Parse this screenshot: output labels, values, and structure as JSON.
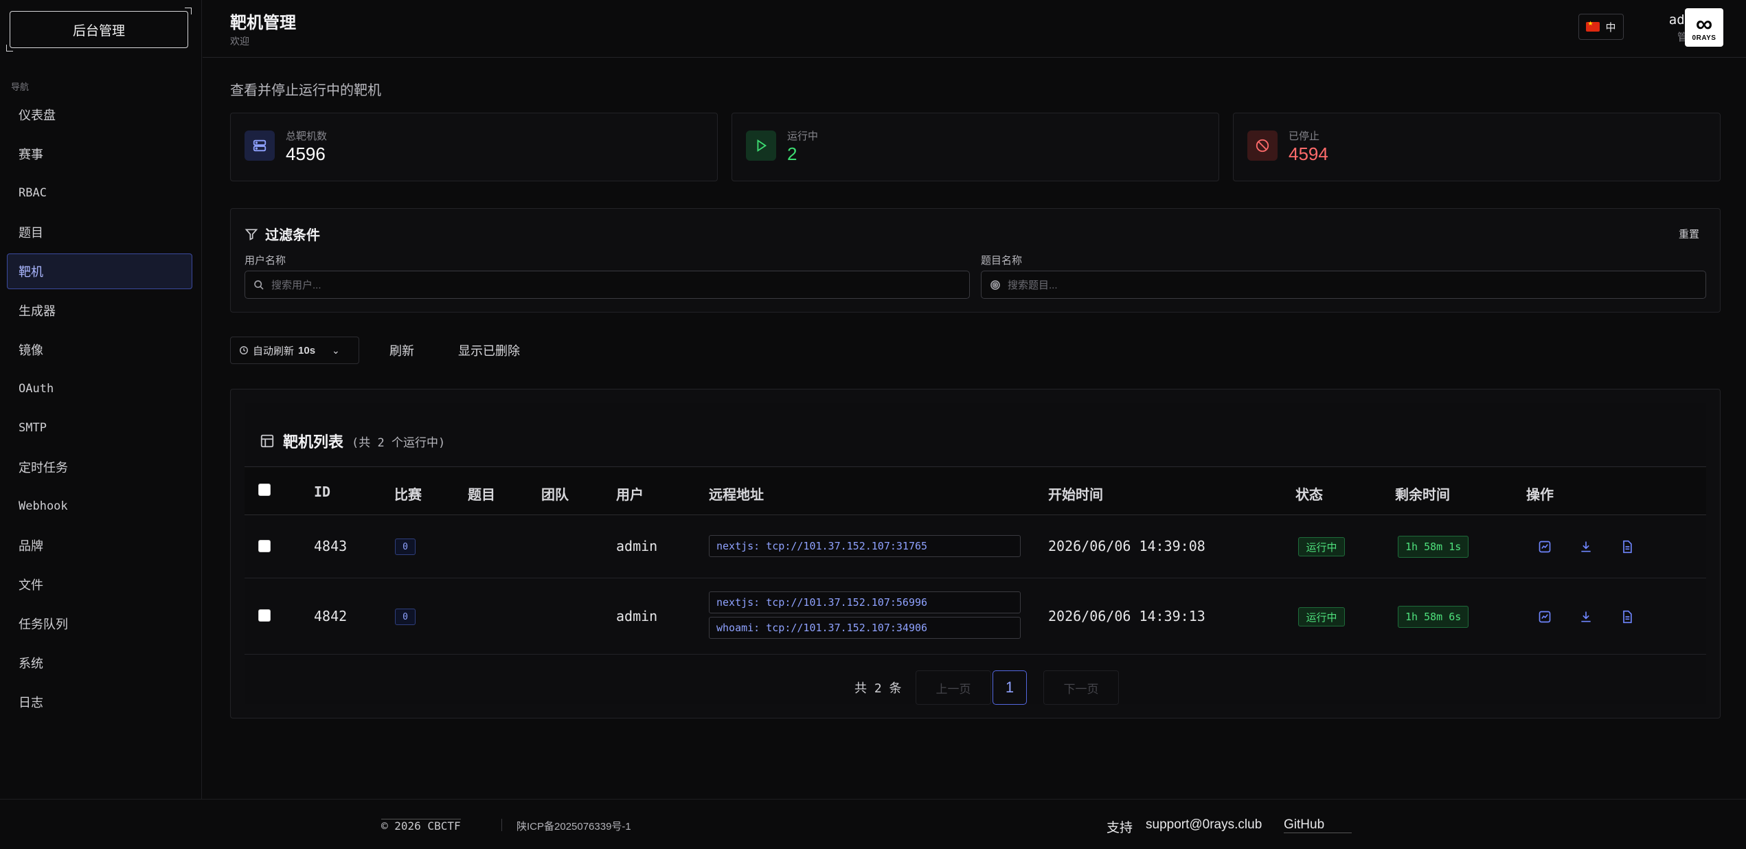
{
  "sidebar": {
    "brand": "后台管理",
    "nav_title": "导航",
    "items": [
      {
        "label": "仪表盘"
      },
      {
        "label": "赛事"
      },
      {
        "label": "RBAC"
      },
      {
        "label": "题目"
      },
      {
        "label": "靶机"
      },
      {
        "label": "生成器"
      },
      {
        "label": "镜像"
      },
      {
        "label": "OAuth"
      },
      {
        "label": "SMTP"
      },
      {
        "label": "定时任务"
      },
      {
        "label": "Webhook"
      },
      {
        "label": "品牌"
      },
      {
        "label": "文件"
      },
      {
        "label": "任务队列"
      },
      {
        "label": "系统"
      },
      {
        "label": "日志"
      }
    ],
    "active_index": 4
  },
  "header": {
    "title": "靶机管理",
    "subtitle": "欢迎",
    "lang": "中",
    "user_name": "admin",
    "user_role": "管理员",
    "avatar_text": "0RAYS"
  },
  "main": {
    "description": "查看并停止运行中的靶机",
    "stats": [
      {
        "label": "总靶机数",
        "value": "4596",
        "color": "#ffffff",
        "icon": "server-icon"
      },
      {
        "label": "运行中",
        "value": "2",
        "color": "#3ddc72",
        "icon": "play-icon"
      },
      {
        "label": "已停止",
        "value": "4594",
        "color": "#ff6b6b",
        "icon": "ban-icon"
      }
    ],
    "filter": {
      "title": "过滤条件",
      "reset": "重置",
      "user_label": "用户名称",
      "user_placeholder": "搜索用户...",
      "challenge_label": "题目名称",
      "challenge_placeholder": "搜索题目..."
    },
    "toolbar": {
      "auto_refresh": "自动刷新",
      "interval": "10s",
      "refresh": "刷新",
      "show_deleted": "显示已删除"
    },
    "table": {
      "title": "靶机列表",
      "count_text": "(共 2 个运行中)",
      "columns": [
        "ID",
        "比赛",
        "题目",
        "团队",
        "用户",
        "远程地址",
        "开始时间",
        "状态",
        "剩余时间",
        "操作"
      ],
      "rows": [
        {
          "id": "4843",
          "contest": "0",
          "challenge": "",
          "team": "",
          "user": "admin",
          "addresses": [
            "nextjs: tcp://101.37.152.107:31765"
          ],
          "start": "2026/06/06 14:39:08",
          "status": "运行中",
          "remaining": "1h 58m 1s"
        },
        {
          "id": "4842",
          "contest": "0",
          "challenge": "",
          "team": "",
          "user": "admin",
          "addresses": [
            "nextjs: tcp://101.37.152.107:56996",
            "whoami: tcp://101.37.152.107:34906"
          ],
          "start": "2026/06/06 14:39:13",
          "status": "运行中",
          "remaining": "1h 58m 6s"
        }
      ]
    },
    "pagination": {
      "total": "共 2 条",
      "prev": "上一页",
      "page": "1",
      "next": "下一页"
    }
  },
  "footer": {
    "copyright": "© 2026 CBCTF",
    "icp": "陕ICP备2025076339号-1",
    "support": "支持",
    "email": "support@0rays.club",
    "github": "GitHub"
  },
  "colors": {
    "accent": "#8fa2ff",
    "running": "#4ee07c",
    "stopped": "#ff6b6b"
  }
}
